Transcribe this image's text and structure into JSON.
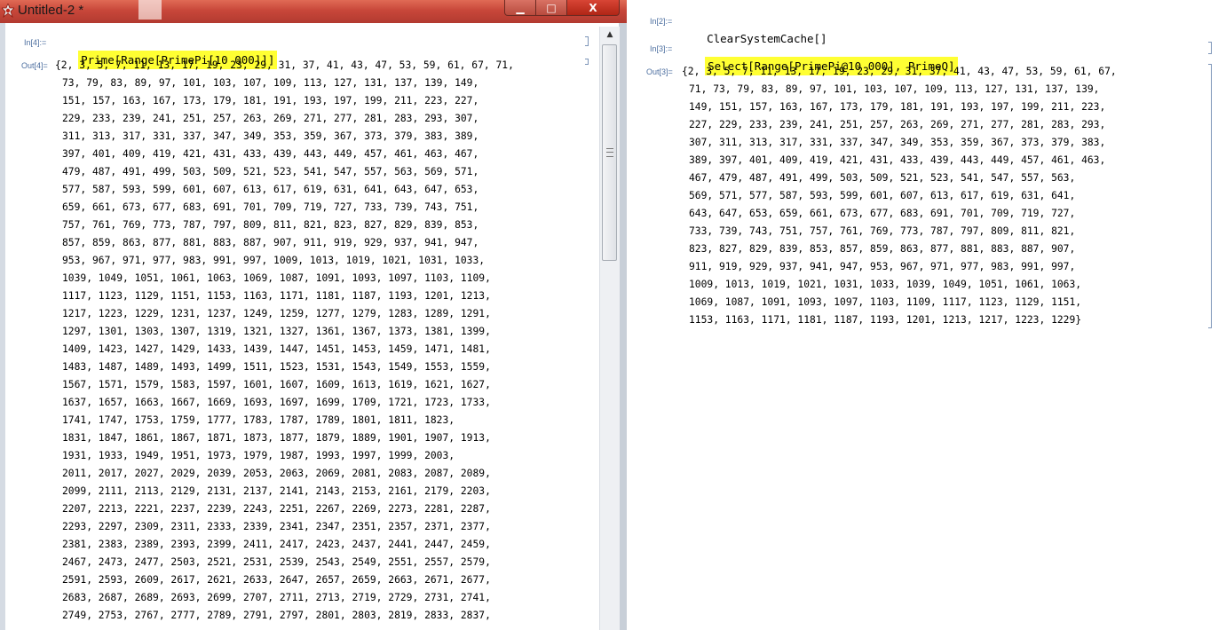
{
  "left": {
    "title": "Untitled-2 *",
    "buttons": {
      "minimize": "▁",
      "maximize": "□",
      "close": "X"
    },
    "in_label": "In[4]:=",
    "input": "Prime[Range[PrimePi[10 000]]]",
    "out_label": "Out[4]=",
    "output_lines": [
      "{2, 3, 5, 7, 11, 13, 17, 19, 23, 29, 31, 37, 41, 43, 47, 53, 59, 61, 67, 71,",
      "73, 79, 83, 89, 97, 101, 103, 107, 109, 113, 127, 131, 137, 139, 149,",
      "151, 157, 163, 167, 173, 179, 181, 191, 193, 197, 199, 211, 223, 227,",
      "229, 233, 239, 241, 251, 257, 263, 269, 271, 277, 281, 283, 293, 307,",
      "311, 313, 317, 331, 337, 347, 349, 353, 359, 367, 373, 379, 383, 389,",
      "397, 401, 409, 419, 421, 431, 433, 439, 443, 449, 457, 461, 463, 467,",
      "479, 487, 491, 499, 503, 509, 521, 523, 541, 547, 557, 563, 569, 571,",
      "577, 587, 593, 599, 601, 607, 613, 617, 619, 631, 641, 643, 647, 653,",
      "659, 661, 673, 677, 683, 691, 701, 709, 719, 727, 733, 739, 743, 751,",
      "757, 761, 769, 773, 787, 797, 809, 811, 821, 823, 827, 829, 839, 853,",
      "857, 859, 863, 877, 881, 883, 887, 907, 911, 919, 929, 937, 941, 947,",
      "953, 967, 971, 977, 983, 991, 997, 1009, 1013, 1019, 1021, 1031, 1033,",
      "1039, 1049, 1051, 1061, 1063, 1069, 1087, 1091, 1093, 1097, 1103, 1109,",
      "1117, 1123, 1129, 1151, 1153, 1163, 1171, 1181, 1187, 1193, 1201, 1213,",
      "1217, 1223, 1229, 1231, 1237, 1249, 1259, 1277, 1279, 1283, 1289, 1291,",
      "1297, 1301, 1303, 1307, 1319, 1321, 1327, 1361, 1367, 1373, 1381, 1399,",
      "1409, 1423, 1427, 1429, 1433, 1439, 1447, 1451, 1453, 1459, 1471, 1481,",
      "1483, 1487, 1489, 1493, 1499, 1511, 1523, 1531, 1543, 1549, 1553, 1559,",
      "1567, 1571, 1579, 1583, 1597, 1601, 1607, 1609, 1613, 1619, 1621, 1627,",
      "1637, 1657, 1663, 1667, 1669, 1693, 1697, 1699, 1709, 1721, 1723, 1733,",
      "1741, 1747, 1753, 1759, 1777, 1783, 1787, 1789, 1801, 1811, 1823,",
      "1831, 1847, 1861, 1867, 1871, 1873, 1877, 1879, 1889, 1901, 1907, 1913,",
      "1931, 1933, 1949, 1951, 1973, 1979, 1987, 1993, 1997, 1999, 2003,",
      "2011, 2017, 2027, 2029, 2039, 2053, 2063, 2069, 2081, 2083, 2087, 2089,",
      "2099, 2111, 2113, 2129, 2131, 2137, 2141, 2143, 2153, 2161, 2179, 2203,",
      "2207, 2213, 2221, 2237, 2239, 2243, 2251, 2267, 2269, 2273, 2281, 2287,",
      "2293, 2297, 2309, 2311, 2333, 2339, 2341, 2347, 2351, 2357, 2371, 2377,",
      "2381, 2383, 2389, 2393, 2399, 2411, 2417, 2423, 2437, 2441, 2447, 2459,",
      "2467, 2473, 2477, 2503, 2521, 2531, 2539, 2543, 2549, 2551, 2557, 2579,",
      "2591, 2593, 2609, 2617, 2621, 2633, 2647, 2657, 2659, 2663, 2671, 2677,",
      "2683, 2687, 2689, 2693, 2699, 2707, 2711, 2713, 2719, 2729, 2731, 2741,",
      "2749, 2753, 2767, 2777, 2789, 2791, 2797, 2801, 2803, 2819, 2833, 2837,"
    ]
  },
  "right": {
    "in2_label": "In[2]:=",
    "in2_input": "ClearSystemCache[]",
    "in3_label": "In[3]:=",
    "in3_input": "Select[Range[PrimePi@10 000], PrimeQ]",
    "out3_label": "Out[3]=",
    "output_lines": [
      "{2, 3, 5, 7, 11, 13, 17, 19, 23, 29, 31, 37, 41, 43, 47, 53, 59, 61, 67,",
      "71, 73, 79, 83, 89, 97, 101, 103, 107, 109, 113, 127, 131, 137, 139,",
      "149, 151, 157, 163, 167, 173, 179, 181, 191, 193, 197, 199, 211, 223,",
      "227, 229, 233, 239, 241, 251, 257, 263, 269, 271, 277, 281, 283, 293,",
      "307, 311, 313, 317, 331, 337, 347, 349, 353, 359, 367, 373, 379, 383,",
      "389, 397, 401, 409, 419, 421, 431, 433, 439, 443, 449, 457, 461, 463,",
      "467, 479, 487, 491, 499, 503, 509, 521, 523, 541, 547, 557, 563,",
      "569, 571, 577, 587, 593, 599, 601, 607, 613, 617, 619, 631, 641,",
      "643, 647, 653, 659, 661, 673, 677, 683, 691, 701, 709, 719, 727,",
      "733, 739, 743, 751, 757, 761, 769, 773, 787, 797, 809, 811, 821,",
      "823, 827, 829, 839, 853, 857, 859, 863, 877, 881, 883, 887, 907,",
      "911, 919, 929, 937, 941, 947, 953, 967, 971, 977, 983, 991, 997,",
      "1009, 1013, 1019, 1021, 1031, 1033, 1039, 1049, 1051, 1061, 1063,",
      "1069, 1087, 1091, 1093, 1097, 1103, 1109, 1117, 1123, 1129, 1151,",
      "1153, 1163, 1171, 1181, 1187, 1193, 1201, 1213, 1217, 1223, 1229}"
    ]
  },
  "colors": {
    "highlight": "#ffff33",
    "titlebar": "#c8473a",
    "cell_label": "#4d6fa0"
  }
}
